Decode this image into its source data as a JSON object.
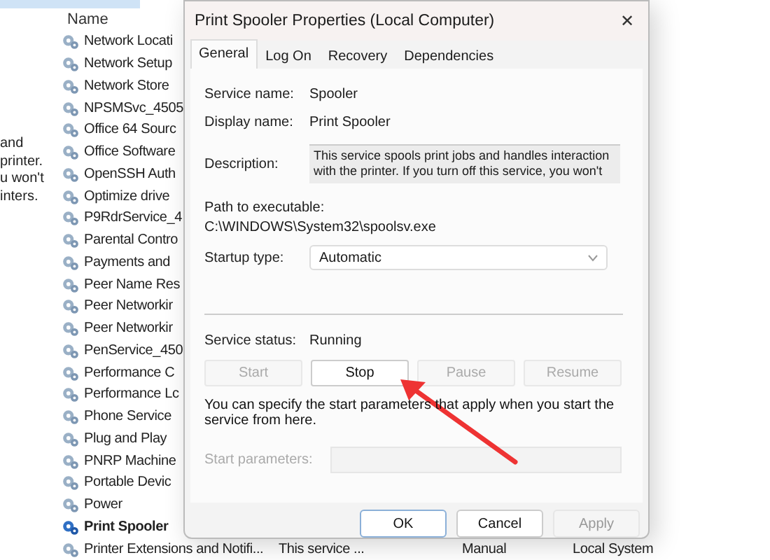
{
  "description_fragments": [
    "and",
    "printer.",
    "u won't",
    "inters."
  ],
  "services_list": {
    "column_header": "Name",
    "rows": [
      {
        "name": "Network Locati",
        "selected": false
      },
      {
        "name": "Network Setup",
        "selected": false
      },
      {
        "name": "Network Store",
        "selected": false
      },
      {
        "name": "NPSMSvc_4505",
        "selected": false
      },
      {
        "name": "Office 64 Sourc",
        "selected": false
      },
      {
        "name": "Office Software",
        "selected": false
      },
      {
        "name": "OpenSSH Auth",
        "selected": false
      },
      {
        "name": "Optimize drive",
        "selected": false
      },
      {
        "name": "P9RdrService_4",
        "selected": false
      },
      {
        "name": "Parental Contro",
        "selected": false
      },
      {
        "name": "Payments and",
        "selected": false
      },
      {
        "name": "Peer Name Res",
        "selected": false
      },
      {
        "name": "Peer Networkir",
        "selected": false
      },
      {
        "name": "Peer Networkir",
        "selected": false
      },
      {
        "name": "PenService_450",
        "selected": false
      },
      {
        "name": "Performance C",
        "selected": false
      },
      {
        "name": "Performance Lc",
        "selected": false
      },
      {
        "name": "Phone Service",
        "selected": false
      },
      {
        "name": "Plug and Play",
        "selected": false
      },
      {
        "name": "PNRP Machine",
        "selected": false
      },
      {
        "name": "Portable Devic",
        "selected": false
      },
      {
        "name": "Power",
        "selected": false
      },
      {
        "name": "Print Spooler",
        "selected": true
      }
    ],
    "bottom_row": {
      "name": "Printer Extensions and Notifi...",
      "description": "This service ...",
      "startup_type": "Manual",
      "log_on_as": "Local System"
    }
  },
  "dialog": {
    "title": "Print Spooler Properties (Local Computer)",
    "close": "✕",
    "tabs": [
      {
        "label": "General",
        "selected": true
      },
      {
        "label": "Log On",
        "selected": false
      },
      {
        "label": "Recovery",
        "selected": false
      },
      {
        "label": "Dependencies",
        "selected": false
      }
    ],
    "service_name": {
      "label": "Service name:",
      "value": "Spooler"
    },
    "display_name": {
      "label": "Display name:",
      "value": "Print Spooler"
    },
    "description": {
      "label": "Description:",
      "lines": [
        "This service spools print jobs and handles interaction",
        "with the printer.  If you turn off this service, you won't"
      ]
    },
    "path": {
      "label": "Path to executable:",
      "value": "C:\\WINDOWS\\System32\\spoolsv.exe"
    },
    "startup_type": {
      "label": "Startup type:",
      "value": "Automatic"
    },
    "service_status": {
      "label": "Service status:",
      "value": "Running"
    },
    "control_buttons": [
      {
        "label": "Start",
        "disabled": true
      },
      {
        "label": "Stop",
        "disabled": false
      },
      {
        "label": "Pause",
        "disabled": true
      },
      {
        "label": "Resume",
        "disabled": true
      }
    ],
    "hint": "You can specify the start parameters that apply when you start the service from here.",
    "start_parameters": {
      "label": "Start parameters:",
      "disabled": true
    },
    "footer_buttons": [
      {
        "label": "OK",
        "disabled": false,
        "selected": true
      },
      {
        "label": "Cancel",
        "disabled": false,
        "selected": false
      },
      {
        "label": "Apply",
        "disabled": true,
        "selected": false
      }
    ]
  }
}
